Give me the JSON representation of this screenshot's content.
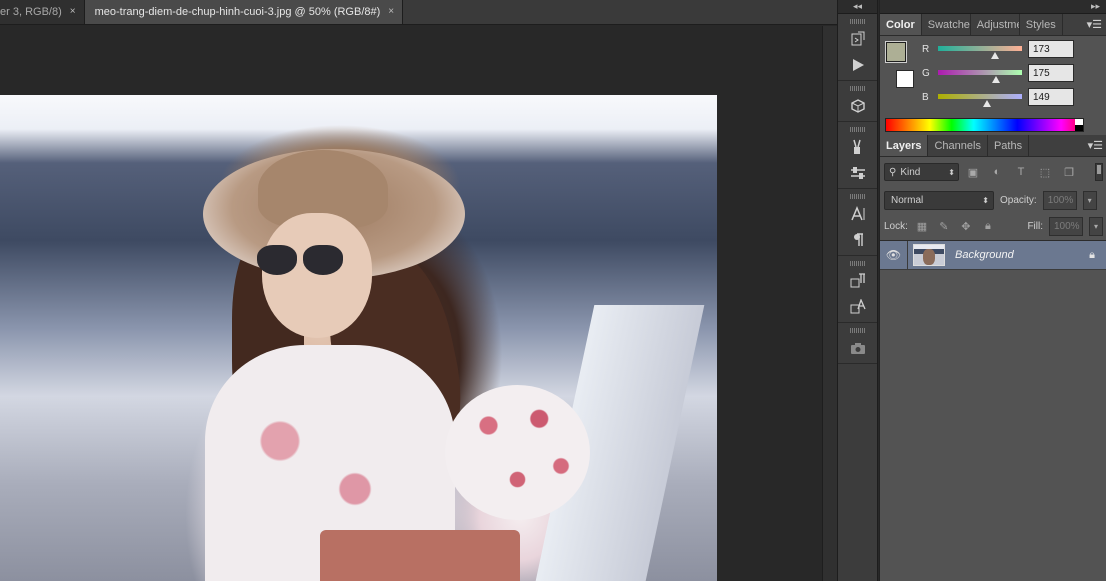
{
  "tabs": [
    {
      "label": "er 3, RGB/8)",
      "active": false
    },
    {
      "label": "meo-trang-diem-de-chup-hinh-cuoi-3.jpg @ 50% (RGB/8#)",
      "active": true
    }
  ],
  "close_glyph": "×",
  "dock": {
    "collapse_glyph": "◂◂",
    "icons": [
      "history-icon",
      "play-action-icon",
      "3d-cube-icon",
      "brush-presets-icon",
      "tool-sliders-icon",
      "character-icon",
      "paragraph-icon",
      "paragraph-styles-icon",
      "character-styles-icon",
      "camera-icon"
    ]
  },
  "panels_top": {
    "collapse_glyph": "▸▸"
  },
  "color_panel": {
    "tabs": [
      "Color",
      "Swatches",
      "Adjustments",
      "Styles"
    ],
    "active_tab": "Color",
    "foreground": "#adaf95",
    "background": "#ffffff",
    "channels": [
      {
        "label": "R",
        "value": "173",
        "fraction": 0.678
      },
      {
        "label": "G",
        "value": "175",
        "fraction": 0.686
      },
      {
        "label": "B",
        "value": "149",
        "fraction": 0.584
      }
    ]
  },
  "layers_panel": {
    "tabs": [
      "Layers",
      "Channels",
      "Paths"
    ],
    "active_tab": "Layers",
    "filter_kind": "Kind",
    "blend_mode": "Normal",
    "opacity_label": "Opacity:",
    "opacity_value": "100%",
    "lock_label": "Lock:",
    "fill_label": "Fill:",
    "fill_value": "100%",
    "layers": [
      {
        "name": "Background",
        "visible": true,
        "locked": true,
        "selected": true
      }
    ]
  },
  "colors": {
    "panel_bg": "#535353",
    "selected_layer": "#6b7890",
    "workspace": "#282828"
  }
}
